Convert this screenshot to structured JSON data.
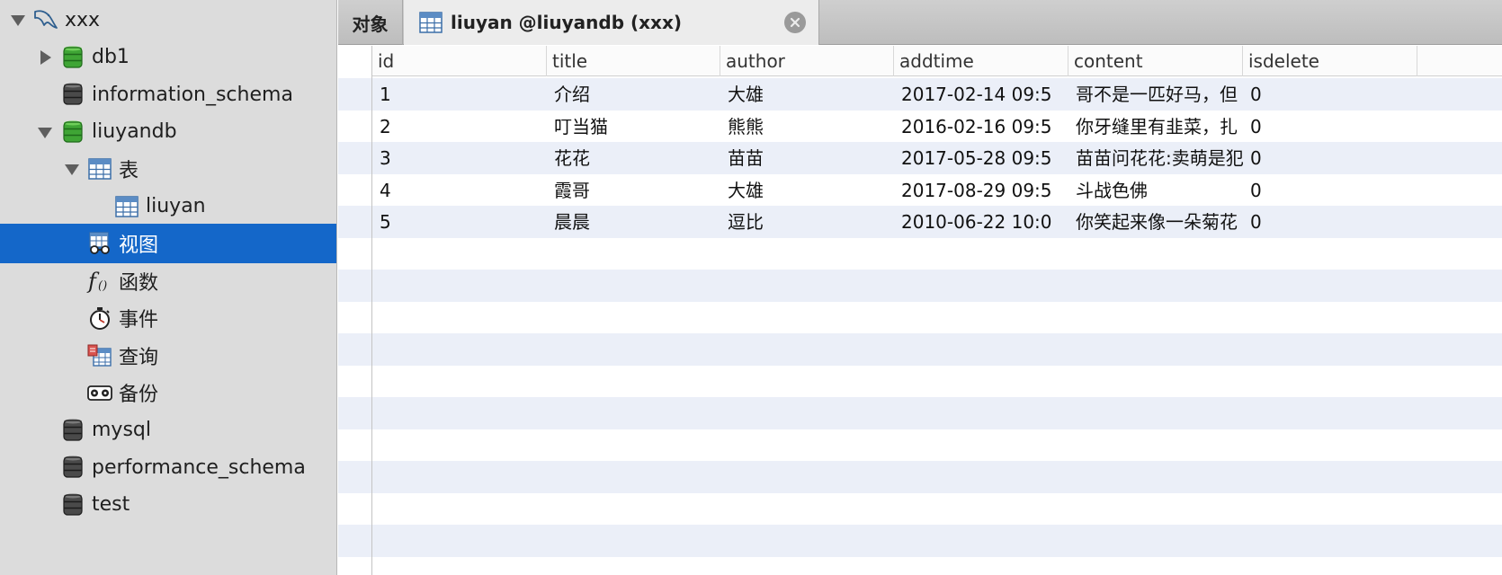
{
  "sidebar": {
    "items": [
      {
        "label": "xxx",
        "icon": "mysql-connection-icon",
        "arrow": "down",
        "indent": 0
      },
      {
        "label": "db1",
        "icon": "database-green-icon",
        "arrow": "right",
        "indent": 1
      },
      {
        "label": "information_schema",
        "icon": "database-gray-icon",
        "arrow": "none",
        "indent": 1
      },
      {
        "label": "liuyandb",
        "icon": "database-green-icon",
        "arrow": "down",
        "indent": 1
      },
      {
        "label": "表",
        "icon": "table-icon",
        "arrow": "down",
        "indent": 2
      },
      {
        "label": "liuyan",
        "icon": "table-icon",
        "arrow": "none",
        "indent": 3
      },
      {
        "label": "视图",
        "icon": "view-icon",
        "arrow": "none",
        "indent": 2
      },
      {
        "label": "函数",
        "icon": "function-icon",
        "arrow": "none",
        "indent": 2
      },
      {
        "label": "事件",
        "icon": "event-icon",
        "arrow": "none",
        "indent": 2
      },
      {
        "label": "查询",
        "icon": "query-icon",
        "arrow": "none",
        "indent": 2
      },
      {
        "label": "备份",
        "icon": "backup-icon",
        "arrow": "none",
        "indent": 2
      },
      {
        "label": "mysql",
        "icon": "database-gray-icon",
        "arrow": "none",
        "indent": 1
      },
      {
        "label": "performance_schema",
        "icon": "database-gray-icon",
        "arrow": "none",
        "indent": 1
      },
      {
        "label": "test",
        "icon": "database-gray-icon",
        "arrow": "none",
        "indent": 1
      }
    ],
    "selected_label": "视图"
  },
  "tabs": {
    "objects_label": "对象",
    "table_tab_label": "liuyan @liuyandb (xxx)"
  },
  "grid": {
    "columns": [
      "id",
      "title",
      "author",
      "addtime",
      "content",
      "isdelete"
    ],
    "rows": [
      [
        "1",
        "介绍",
        "大雄",
        "2017-02-14 09:5",
        "哥不是一匹好马，但",
        "0"
      ],
      [
        "2",
        "叮当猫",
        "熊熊",
        "2016-02-16 09:5",
        "你牙缝里有韭菜，扎",
        "0"
      ],
      [
        "3",
        "花花",
        "苗苗",
        "2017-05-28 09:5",
        "苗苗问花花:卖萌是犯",
        "0"
      ],
      [
        "4",
        "霞哥",
        "大雄",
        "2017-08-29 09:5",
        "斗战色佛",
        "0"
      ],
      [
        "5",
        "晨晨",
        "逗比",
        "2010-06-22 10:0",
        "你笑起来像一朵菊花",
        "0"
      ]
    ]
  },
  "colors": {
    "sidebar_bg": "#dcdcdc",
    "selection": "#1467c9",
    "row_stripe": "#ebeff8",
    "db_green": "#3fa535"
  }
}
